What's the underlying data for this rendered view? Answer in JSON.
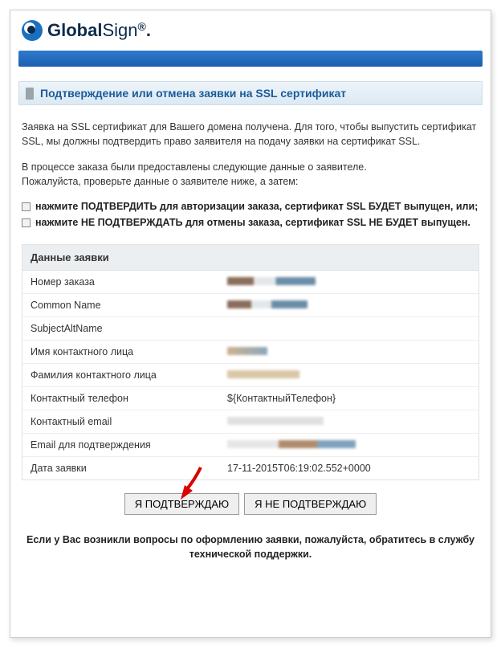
{
  "brand": {
    "name_bold": "Global",
    "name_thin": "Sign"
  },
  "section_title": "Подтверждение или отмена заявки на SSL сертификат",
  "para1": "Заявка на SSL сертификат для Вашего домена получена. Для того, чтобы выпустить сертификат SSL, мы должны подтвердить право заявителя на подачу заявки на сертификат SSL.",
  "para2a": "В процессе заказа были предоставлены следующие данные о заявителе.",
  "para2b": "Пожалуйста, проверьте данные о заявителе ниже, а затем:",
  "check1": "нажмите ПОДТВЕРДИТЬ для авторизации заказа, сертификат SSL БУДЕТ выпущен, или;",
  "check2": "нажмите НЕ ПОДТВЕРЖДАТЬ для отмены заказа, сертификат SSL НЕ БУДЕТ выпущен.",
  "data_head": "Данные заявки",
  "rows": {
    "r0": {
      "label": "Номер заказа"
    },
    "r1": {
      "label": "Common Name"
    },
    "r2": {
      "label": "SubjectAltName"
    },
    "r3": {
      "label": "Имя контактного лица"
    },
    "r4": {
      "label": "Фамилия контактного лица"
    },
    "r5": {
      "label": "Контактный телефон",
      "value": "${КонтактныйТелефон}"
    },
    "r6": {
      "label": "Контактный email"
    },
    "r7": {
      "label": "Email для подтверждения"
    },
    "r8": {
      "label": "Дата заявки",
      "value": "17-11-2015T06:19:02.552+0000"
    }
  },
  "btn_confirm": "Я ПОДТВЕРЖДАЮ",
  "btn_deny": "Я НЕ ПОДТВЕРЖДАЮ",
  "footer": "Если у Вас возникли вопросы по оформлению заявки, пожалуйста, обратитесь в службу технической поддержки."
}
